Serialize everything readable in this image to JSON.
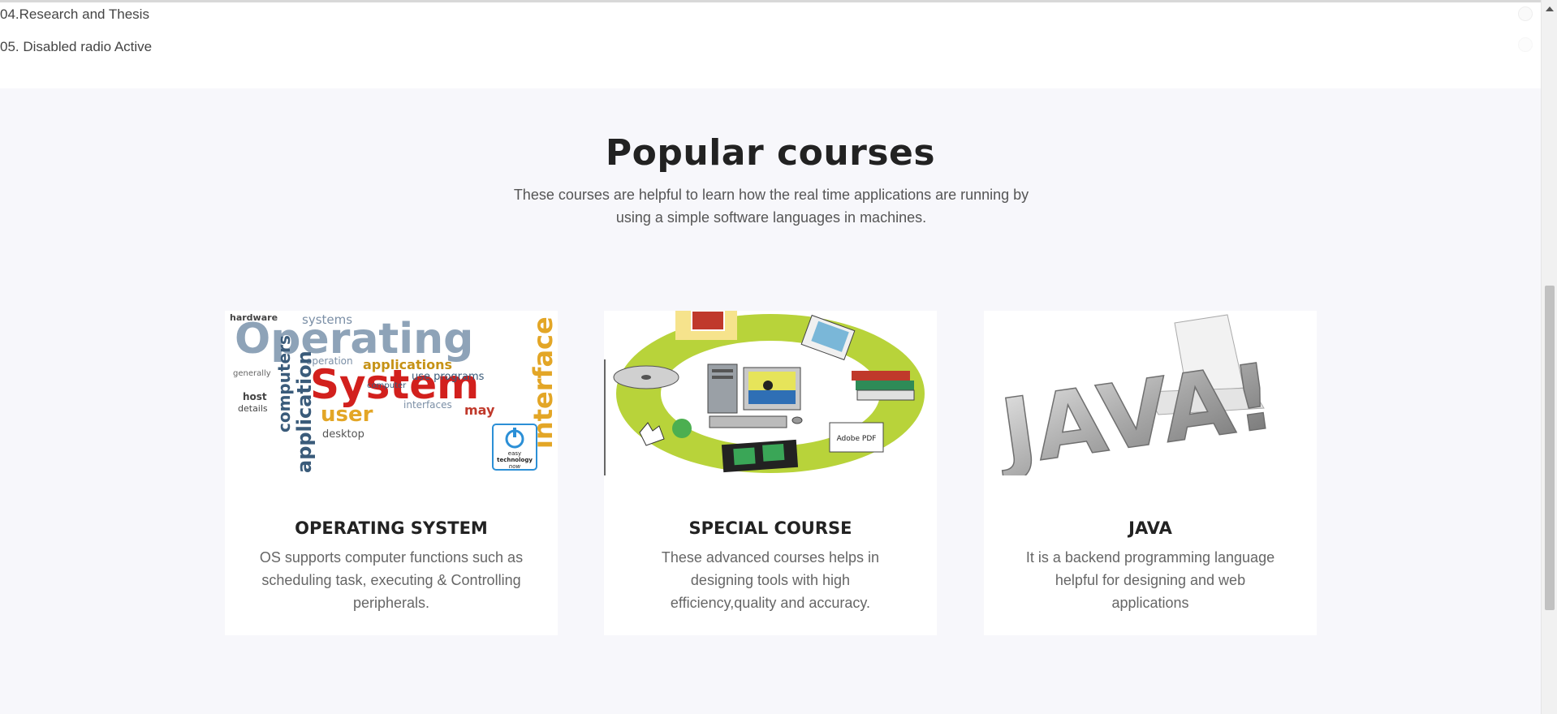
{
  "top_list": {
    "items": [
      "04.Research and Thesis",
      "05. Disabled radio Active"
    ]
  },
  "courses_section": {
    "title": "Popular courses",
    "subtitle": "These courses are helpful to learn how the real time applications are running by using a simple software languages in machines.",
    "cards": [
      {
        "title": "OPERATING SYSTEM",
        "description": "OS supports computer functions such as scheduling task, executing & Controlling peripherals.",
        "image": "operating-system-word-cloud",
        "image_words": {
          "main1": "Operating",
          "main2": "System",
          "side": "interface",
          "user": "user",
          "apps": "applications",
          "computers": "computers",
          "application": "application",
          "hardware": "hardware",
          "systems": "systems",
          "desktop": "desktop",
          "may": "may",
          "badge_line1": "easy",
          "badge_line2": "technology",
          "badge_line3": "now"
        }
      },
      {
        "title": "SPECIAL COURSE",
        "description": "These advanced courses helps in designing tools with high efficiency,quality and accuracy.",
        "image": "computer-tools-ring",
        "image_words": {
          "pdf": "Adobe PDF"
        }
      },
      {
        "title": "JAVA",
        "description": "It is a backend programming language helpful for designing and web applications",
        "image": "java-3d-letters",
        "image_words": {
          "logo": "JAVA!"
        }
      }
    ]
  },
  "colors": {
    "section_bg": "#f7f7fb",
    "heading": "#222222",
    "body_text": "#666666"
  }
}
